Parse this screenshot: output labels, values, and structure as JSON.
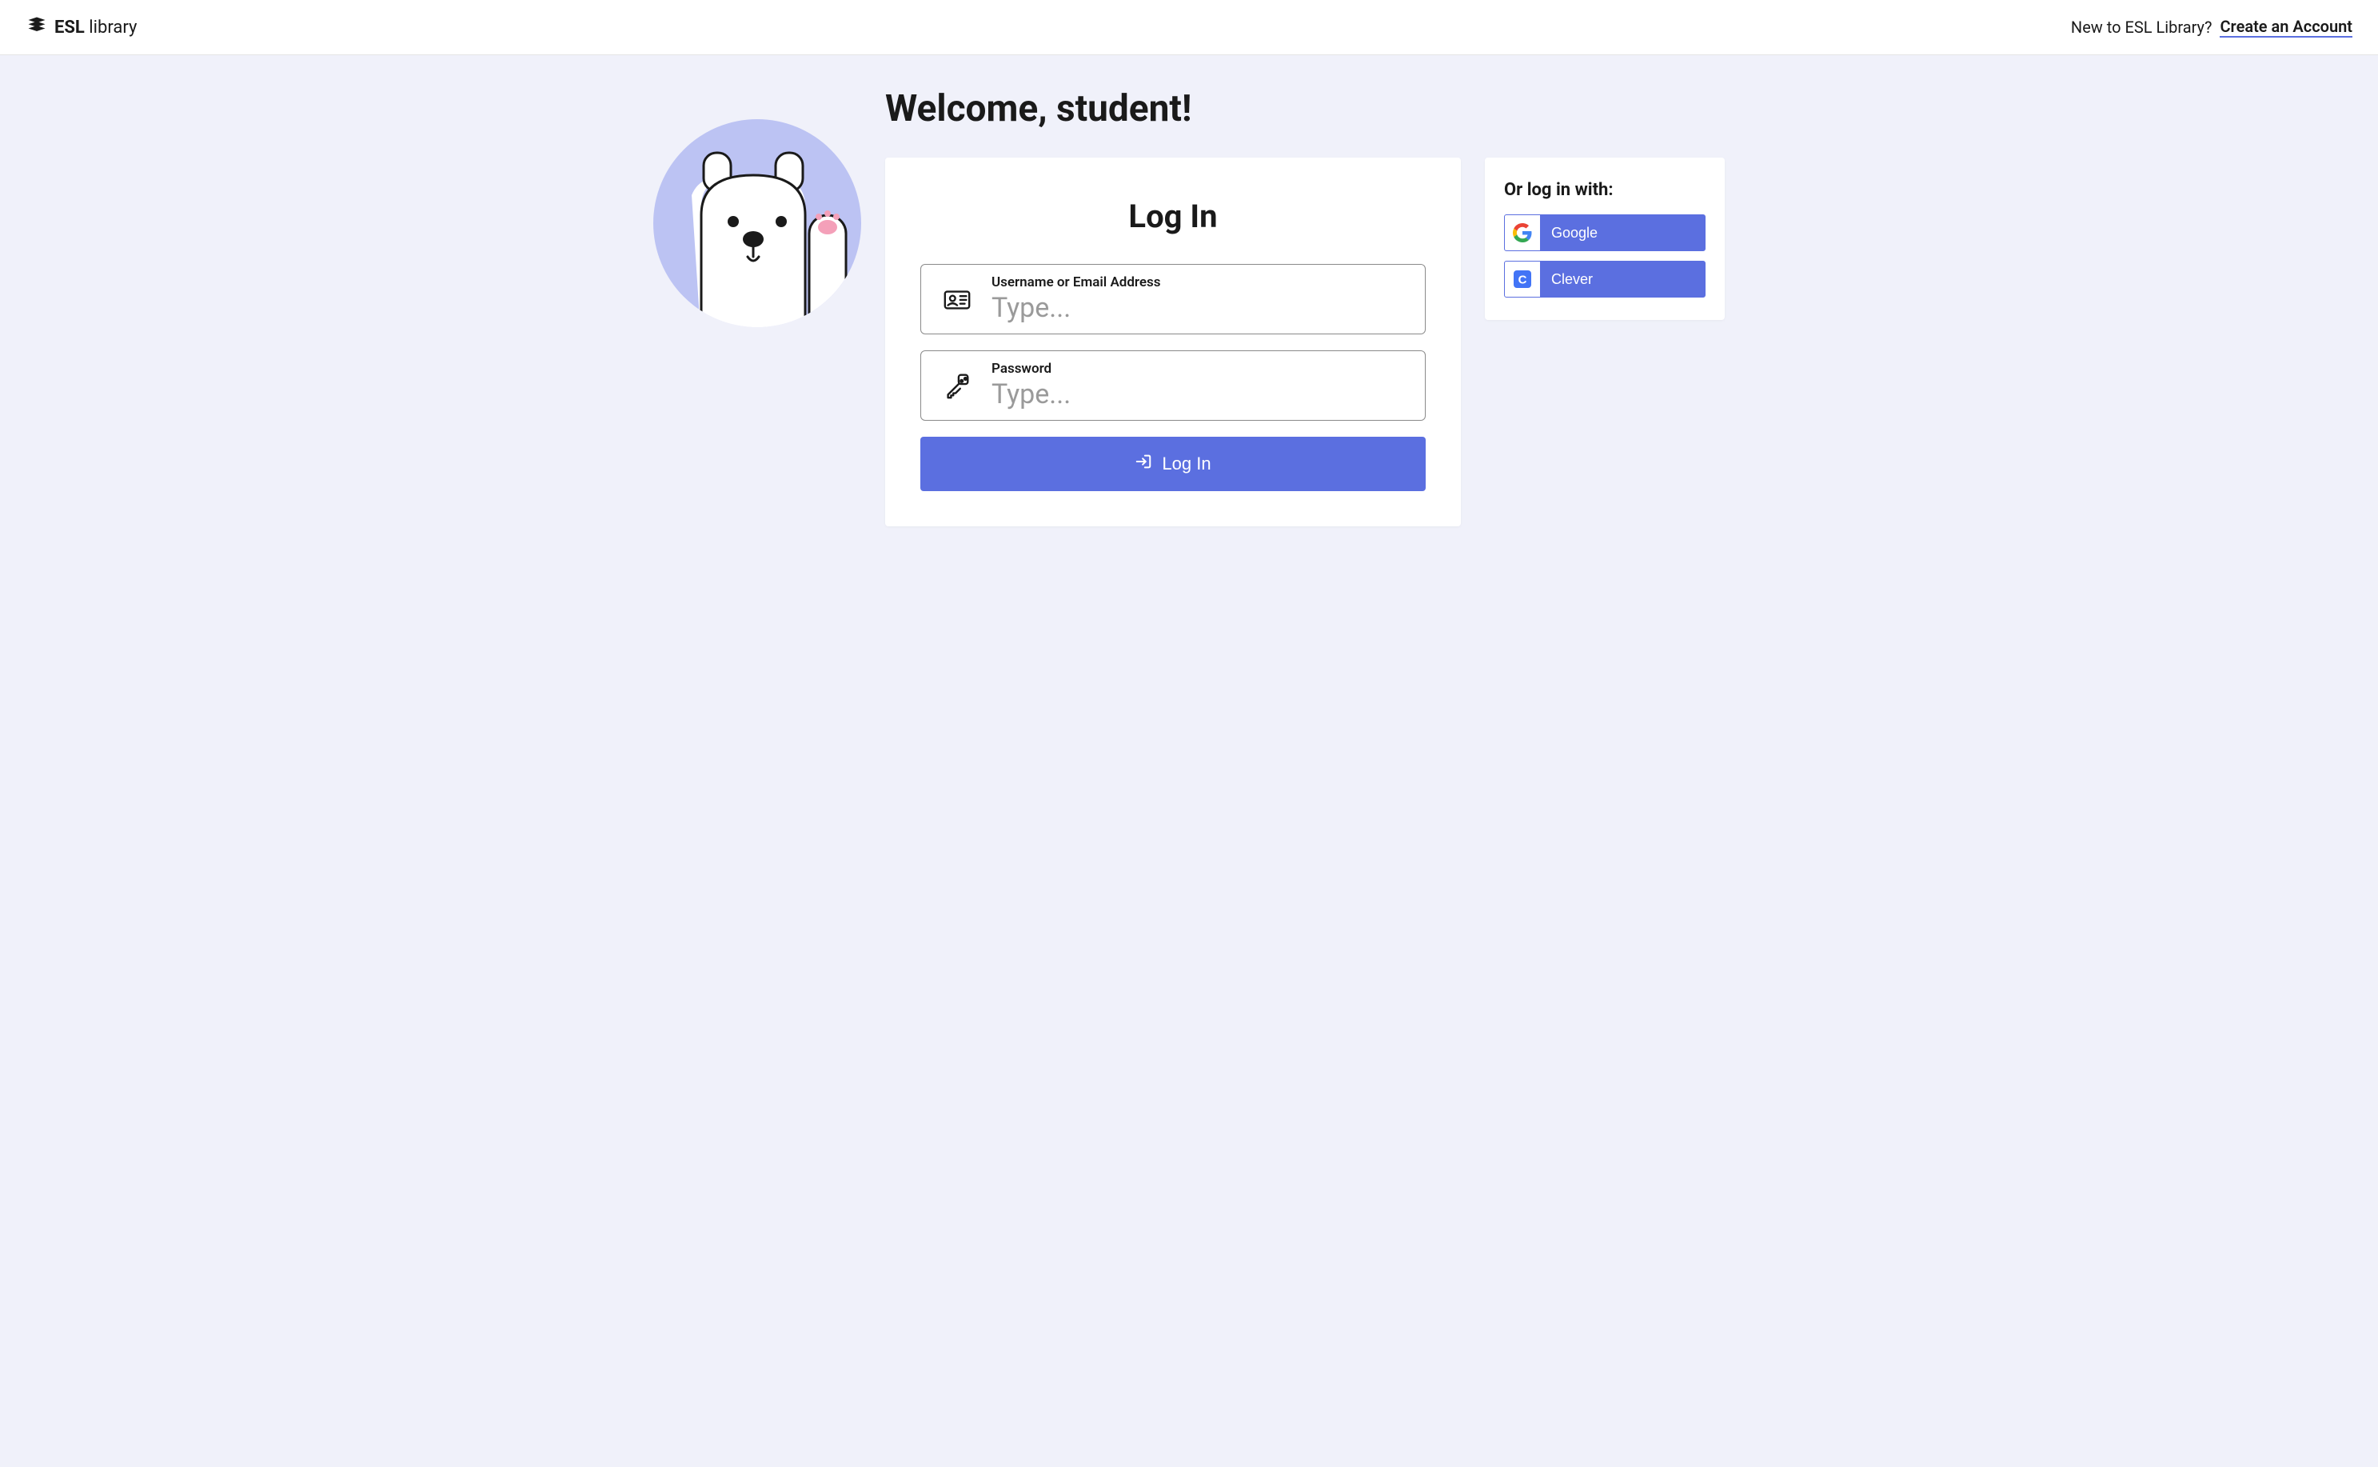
{
  "header": {
    "brand_bold": "ESL",
    "brand_rest": " library",
    "prompt": "New to ESL Library?",
    "create_link": "Create an Account"
  },
  "welcome": "Welcome, student!",
  "login": {
    "title": "Log In",
    "username_label": "Username or Email Address",
    "username_placeholder": "Type...",
    "password_label": "Password",
    "password_placeholder": "Type...",
    "submit": "Log In"
  },
  "sso": {
    "title": "Or log in with:",
    "providers": [
      {
        "label": "Google"
      },
      {
        "label": "Clever"
      }
    ]
  }
}
